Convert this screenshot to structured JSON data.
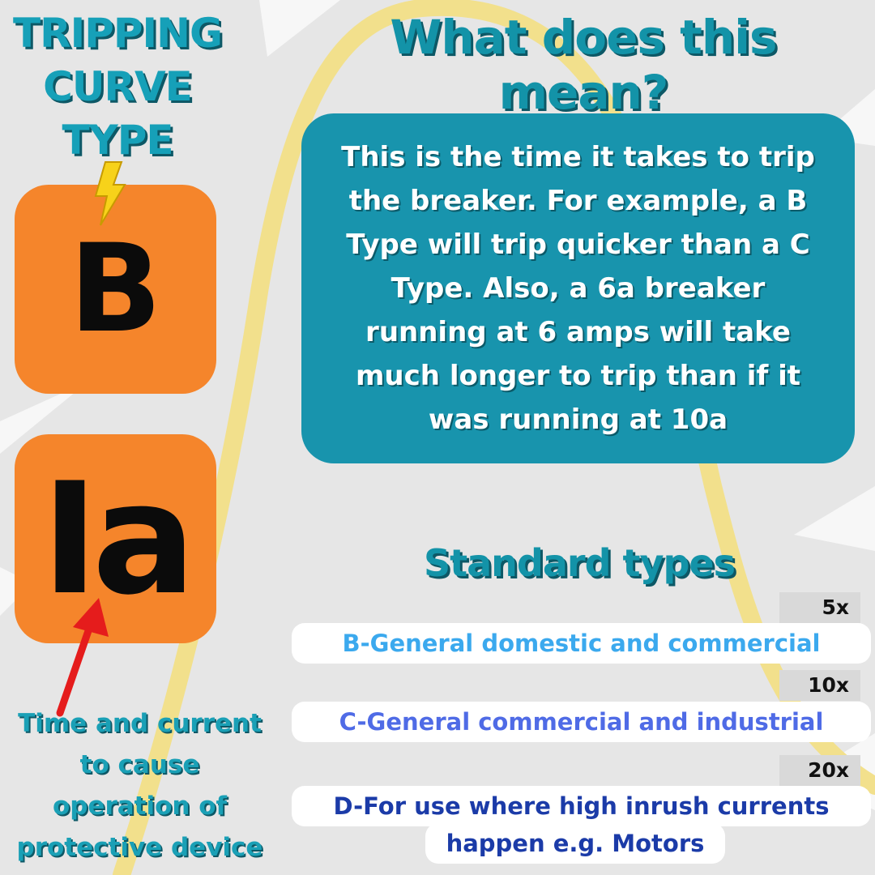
{
  "left": {
    "title_lines": [
      "TRIPPING",
      "CURVE",
      "TYPE"
    ],
    "tile_top_letter": "B",
    "tile_bottom_letters": "Ia",
    "caption_lines": [
      "Time and current",
      "to cause",
      "operation of",
      "protective device"
    ]
  },
  "right": {
    "heading": "What does this mean?",
    "explanation": "This is the time it takes to trip the breaker. For example, a B Type will trip quicker than a C Type.  Also, a 6a breaker running at 6 amps  will take much longer to trip than if it was running at 10a",
    "standard_heading": "Standard types",
    "types": [
      {
        "multiplier": "5x",
        "label": "B-General domestic and commercial",
        "color": "#3ba9ee"
      },
      {
        "multiplier": "10x",
        "label": "C-General commercial and industrial",
        "color": "#4f6be6"
      },
      {
        "multiplier": "20x",
        "label_line1": "D-For use where high inrush currents",
        "label_line2": "happen e.g. Motors",
        "color": "#1b3ba8"
      }
    ]
  },
  "colors": {
    "background": "#e6e6e6",
    "accent_teal": "#1894ad",
    "tile_orange": "#f5852b",
    "curve_yellow": "#f2e08c",
    "arrow_red": "#e51c1c"
  },
  "icons": {
    "bolt": "lightning-bolt-icon",
    "arrow": "red-arrow-icon"
  }
}
